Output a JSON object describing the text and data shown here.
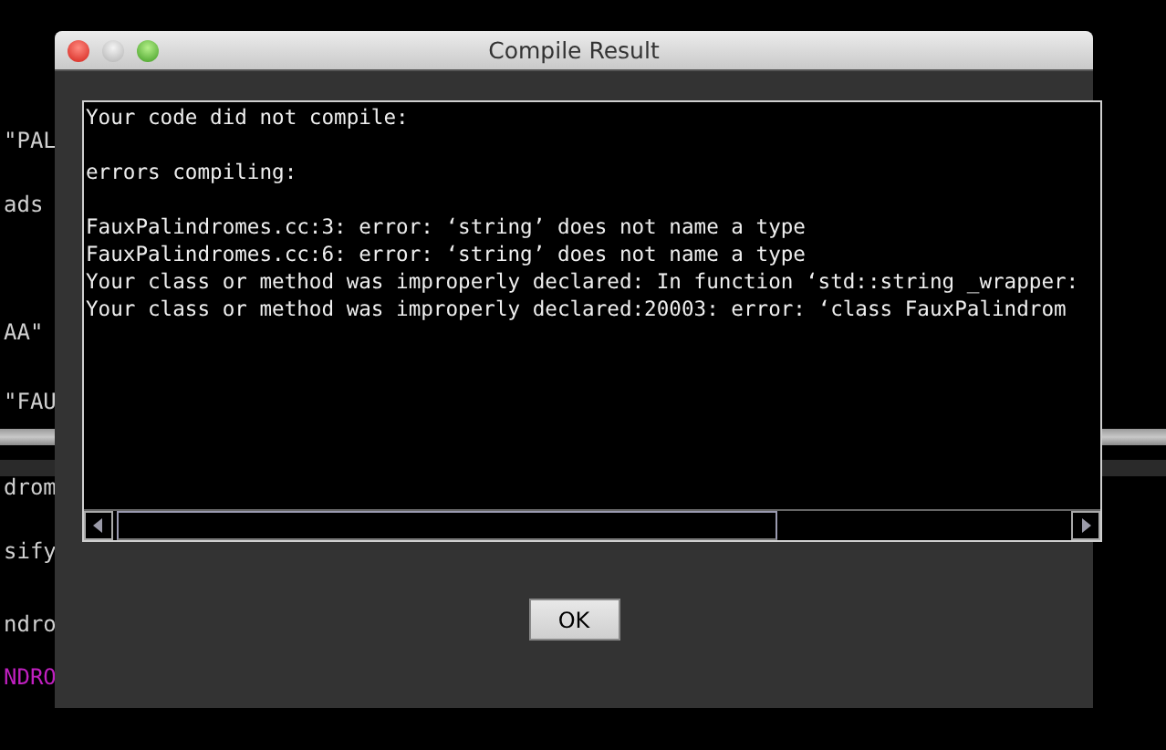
{
  "editor": {
    "lines": [
      {
        "text": "\"PAL",
        "kind": "code"
      },
      {
        "text": "ads",
        "kind": "code"
      },
      {
        "text": "AA\"",
        "kind": "code"
      },
      {
        "text": "\"FAU",
        "kind": "code"
      },
      {
        "text": "drom",
        "kind": "code"
      },
      {
        "text": "sify",
        "kind": "code"
      },
      {
        "text": "ndro",
        "kind": "code"
      },
      {
        "text": "NDRO",
        "kind": "keyword"
      }
    ]
  },
  "dialog": {
    "title": "Compile Result",
    "output_paragraphs": [
      [
        "Your code did not compile:"
      ],
      [
        "errors compiling:"
      ],
      [
        "FauxPalindromes.cc:3: error: ‘string’ does not name a type",
        "FauxPalindromes.cc:6: error: ‘string’ does not name a type",
        "Your class or method was improperly declared: In function ‘std::string _wrapper:",
        "Your class or method was improperly declared:20003: error: ‘class FauxPalindrom"
      ]
    ],
    "buttons": [
      "OK"
    ]
  }
}
